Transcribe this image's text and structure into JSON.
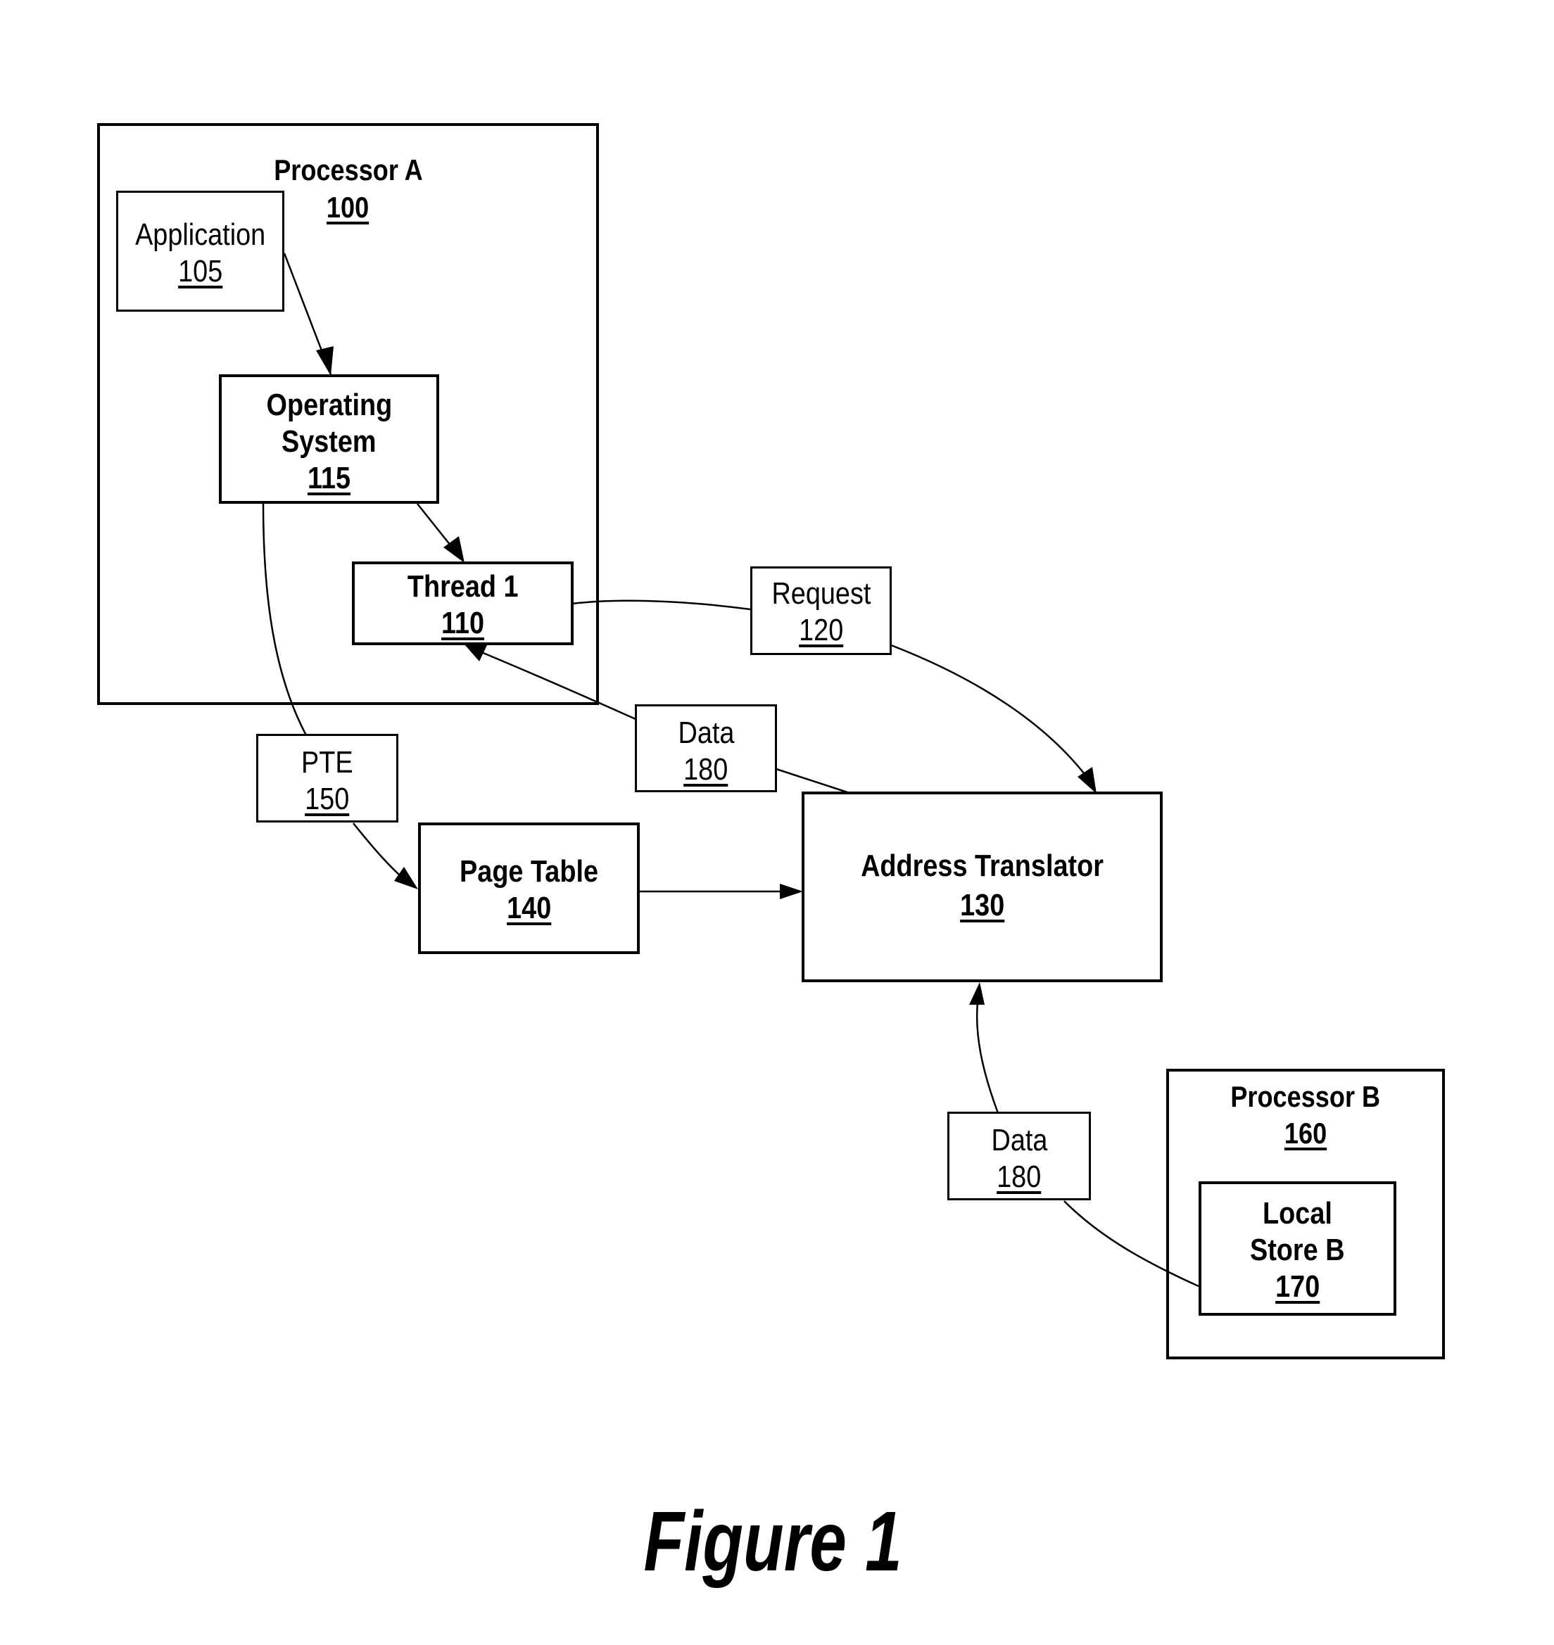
{
  "figure": {
    "caption": "Figure 1"
  },
  "nodes": {
    "processor_a": {
      "label": "Processor A",
      "ref": "100"
    },
    "application": {
      "label": "Application",
      "ref": "105"
    },
    "operating_system": {
      "label_line1": "Operating",
      "label_line2": "System",
      "ref": "115"
    },
    "thread_1": {
      "label": "Thread 1",
      "ref": "110"
    },
    "request": {
      "label": "Request",
      "ref": "120"
    },
    "data_top": {
      "label": "Data",
      "ref": "180"
    },
    "pte": {
      "label": "PTE",
      "ref": "150"
    },
    "page_table": {
      "label": "Page Table",
      "ref": "140"
    },
    "address_translator": {
      "label": "Address Translator",
      "ref": "130"
    },
    "data_bottom": {
      "label": "Data",
      "ref": "180"
    },
    "processor_b": {
      "label": "Processor B",
      "ref": "160"
    },
    "local_store_b": {
      "label_line1": "Local",
      "label_line2": "Store B",
      "ref": "170"
    }
  },
  "edges": [
    {
      "from": "Application 105",
      "to": "Operating System 115",
      "arrow": "end"
    },
    {
      "from": "Operating System 115",
      "to": "Thread 1 110",
      "arrow": "end"
    },
    {
      "from": "Thread 1 110",
      "to": "Request 120",
      "arrow": "none"
    },
    {
      "from": "Request 120",
      "to": "Address Translator 130",
      "arrow": "end"
    },
    {
      "from": "Address Translator 130",
      "to": "Data 180",
      "arrow": "none"
    },
    {
      "from": "Data 180",
      "to": "Thread 1 110",
      "arrow": "end"
    },
    {
      "from": "Operating System 115",
      "to": "PTE 150",
      "arrow": "none"
    },
    {
      "from": "PTE 150",
      "to": "Page Table 140",
      "arrow": "end"
    },
    {
      "from": "Page Table 140",
      "to": "Address Translator 130",
      "arrow": "end"
    },
    {
      "from": "Local Store B 170",
      "to": "Data 180",
      "arrow": "none"
    },
    {
      "from": "Data 180",
      "to": "Address Translator 130",
      "arrow": "end"
    }
  ]
}
